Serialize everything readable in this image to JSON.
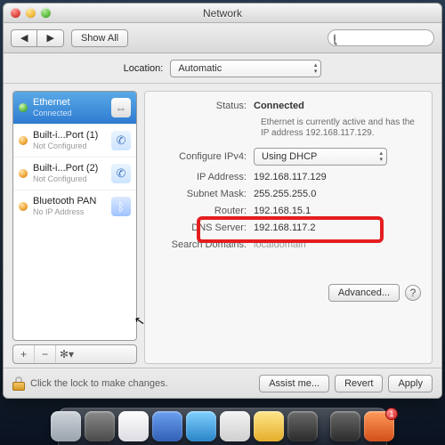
{
  "window": {
    "title": "Network"
  },
  "toolbar": {
    "show_all": "Show All",
    "search_placeholder": ""
  },
  "location": {
    "label": "Location:",
    "value": "Automatic"
  },
  "sources": [
    {
      "name": "Ethernet",
      "sub": "Connected",
      "dot": "green",
      "icon": "eth",
      "selected": true
    },
    {
      "name": "Built-i...Port (1)",
      "sub": "Not Configured",
      "dot": "orange",
      "icon": "phone",
      "selected": false
    },
    {
      "name": "Built-i...Port (2)",
      "sub": "Not Configured",
      "dot": "orange",
      "icon": "phone",
      "selected": false
    },
    {
      "name": "Bluetooth PAN",
      "sub": "No IP Address",
      "dot": "orange",
      "icon": "bt",
      "selected": false
    }
  ],
  "footer_buttons": {
    "add": "+",
    "remove": "−",
    "gear": "✻▾"
  },
  "detail": {
    "status_label": "Status:",
    "status_value": "Connected",
    "status_desc": "Ethernet is currently active and has the IP address 192.168.117.129.",
    "config_label": "Configure IPv4:",
    "config_value": "Using DHCP",
    "ip_label": "IP Address:",
    "ip_value": "192.168.117.129",
    "subnet_label": "Subnet Mask:",
    "subnet_value": "255.255.255.0",
    "router_label": "Router:",
    "router_value": "192.168.15.1",
    "dns_label": "DNS Server:",
    "dns_value": "192.168.117.2",
    "search_label": "Search Domains:",
    "search_value": "localdomain",
    "advanced": "Advanced..."
  },
  "bottom": {
    "lock_text": "Click the lock to make changes.",
    "assist": "Assist me...",
    "revert": "Revert",
    "apply": "Apply"
  },
  "dock": {
    "badge": "1",
    "colors": [
      "#9aa2ad",
      "#6a6a6a",
      "#e8e8ec",
      "#3f76d6",
      "#3ba0e8",
      "#e2e2e2",
      "#f4cf4d",
      "#4a4a4a",
      "#4a4a4a",
      "#e76b33"
    ]
  }
}
